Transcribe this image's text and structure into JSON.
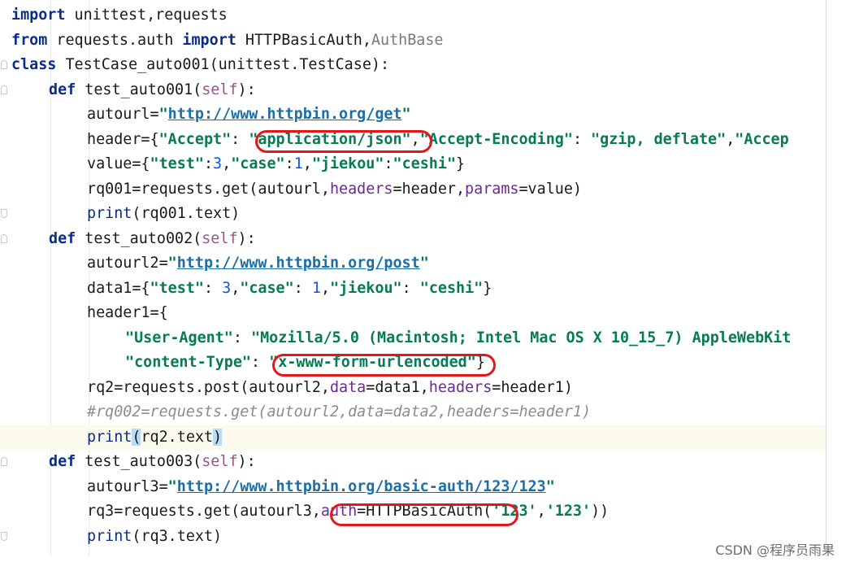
{
  "lines": [
    {
      "indent": 0,
      "parts": [
        [
          "import",
          "kw"
        ],
        [
          " unittest,requests",
          "plain"
        ]
      ]
    },
    {
      "indent": 0,
      "parts": [
        [
          "from",
          "kw"
        ],
        [
          " requests.auth ",
          "plain"
        ],
        [
          "import",
          "kw"
        ],
        [
          " HTTPBasicAuth,",
          "plain"
        ],
        [
          "AuthBase",
          "cmt-plain"
        ]
      ]
    },
    {
      "indent": 0,
      "parts": [
        [
          "class",
          "kw"
        ],
        [
          " TestCase_auto001(unittest.TestCase):",
          "plain"
        ]
      ]
    },
    {
      "indent": 1,
      "parts": [
        [
          "def",
          "kw"
        ],
        [
          " test_auto001(",
          "plain"
        ],
        [
          "self",
          "self"
        ],
        [
          "):",
          "plain"
        ]
      ]
    },
    {
      "indent": 2,
      "parts": [
        [
          "autourl=",
          "plain"
        ],
        [
          "\"",
          "str"
        ],
        [
          "http://www.httpbin.org/get",
          "url"
        ],
        [
          "\"",
          "str"
        ]
      ]
    },
    {
      "indent": 2,
      "parts": [
        [
          "header={",
          "plain"
        ],
        [
          "\"Accept\"",
          "str"
        ],
        [
          ": ",
          "plain"
        ],
        [
          "\"application/json\"",
          "str"
        ],
        [
          ",",
          "plain"
        ],
        [
          "\"Accept-Encoding\"",
          "str"
        ],
        [
          ": ",
          "plain"
        ],
        [
          "\"gzip, deflate\"",
          "str"
        ],
        [
          ",",
          "plain"
        ],
        [
          "\"Accep",
          "str"
        ]
      ]
    },
    {
      "indent": 2,
      "parts": [
        [
          "value={",
          "plain"
        ],
        [
          "\"test\"",
          "str"
        ],
        [
          ":",
          "plain"
        ],
        [
          "3",
          "num"
        ],
        [
          ",",
          "plain"
        ],
        [
          "\"case\"",
          "str"
        ],
        [
          ":",
          "plain"
        ],
        [
          "1",
          "num"
        ],
        [
          ",",
          "plain"
        ],
        [
          "\"jiekou\"",
          "str"
        ],
        [
          ":",
          "plain"
        ],
        [
          "\"ceshi\"",
          "str"
        ],
        [
          "}",
          "plain"
        ]
      ]
    },
    {
      "indent": 2,
      "parts": [
        [
          "rq001=requests.get(autourl,",
          "plain"
        ],
        [
          "headers",
          "param"
        ],
        [
          "=header,",
          "plain"
        ],
        [
          "params",
          "param"
        ],
        [
          "=value)",
          "plain"
        ]
      ]
    },
    {
      "indent": 2,
      "parts": [
        [
          "print",
          "builtin"
        ],
        [
          "(rq001.text)",
          "plain"
        ]
      ]
    },
    {
      "indent": 1,
      "parts": [
        [
          "def",
          "kw"
        ],
        [
          " test_auto002(",
          "plain"
        ],
        [
          "self",
          "self"
        ],
        [
          "):",
          "plain"
        ]
      ]
    },
    {
      "indent": 2,
      "parts": [
        [
          "autourl2=",
          "plain"
        ],
        [
          "\"",
          "str"
        ],
        [
          "http://www.httpbin.org/post",
          "url"
        ],
        [
          "\"",
          "str"
        ]
      ]
    },
    {
      "indent": 2,
      "parts": [
        [
          "data1={",
          "plain"
        ],
        [
          "\"test\"",
          "str"
        ],
        [
          ": ",
          "plain"
        ],
        [
          "3",
          "num"
        ],
        [
          ",",
          "plain"
        ],
        [
          "\"case\"",
          "str"
        ],
        [
          ": ",
          "plain"
        ],
        [
          "1",
          "num"
        ],
        [
          ",",
          "plain"
        ],
        [
          "\"jiekou\"",
          "str"
        ],
        [
          ": ",
          "plain"
        ],
        [
          "\"ceshi\"",
          "str"
        ],
        [
          "}",
          "plain"
        ]
      ]
    },
    {
      "indent": 2,
      "parts": [
        [
          "header1={",
          "plain"
        ]
      ]
    },
    {
      "indent": 3,
      "parts": [
        [
          "\"User-Agent\"",
          "str"
        ],
        [
          ": ",
          "plain"
        ],
        [
          "\"Mozilla/5.0 (Macintosh; Intel Mac OS X 10_15_7) AppleWebKit",
          "str"
        ]
      ]
    },
    {
      "indent": 3,
      "parts": [
        [
          "\"content-Type\"",
          "str"
        ],
        [
          ": ",
          "plain"
        ],
        [
          "\"x-www-form-urlencoded\"",
          "str"
        ],
        [
          "}",
          "plain"
        ]
      ]
    },
    {
      "indent": 2,
      "parts": [
        [
          "rq2=requests.post(autourl2,",
          "plain"
        ],
        [
          "data",
          "param"
        ],
        [
          "=data1,",
          "plain"
        ],
        [
          "headers",
          "param"
        ],
        [
          "=header1)",
          "plain"
        ]
      ]
    },
    {
      "indent": 2,
      "parts": [
        [
          "#rq002=requests.get(autourl2,data=data2,headers=header1)",
          "cmt"
        ]
      ]
    },
    {
      "indent": 2,
      "current": true,
      "parts": [
        [
          "print",
          "builtin"
        ],
        [
          "(",
          "bracket"
        ],
        [
          "rq2.text",
          "plain"
        ],
        [
          ")",
          "bracket"
        ]
      ]
    },
    {
      "indent": 1,
      "parts": [
        [
          "def",
          "kw"
        ],
        [
          " test_auto003(",
          "plain"
        ],
        [
          "self",
          "self"
        ],
        [
          "):",
          "plain"
        ]
      ]
    },
    {
      "indent": 2,
      "parts": [
        [
          "autourl3=",
          "plain"
        ],
        [
          "\"",
          "str"
        ],
        [
          "http://www.httpbin.org/basic-auth/123/123",
          "url"
        ],
        [
          "\"",
          "str"
        ]
      ]
    },
    {
      "indent": 2,
      "parts": [
        [
          "rq3=requests.get(autourl3,",
          "plain"
        ],
        [
          "auth",
          "param"
        ],
        [
          "=HTTPBasicAuth(",
          "plain"
        ],
        [
          "'123'",
          "str"
        ],
        [
          ",",
          "plain"
        ],
        [
          "'123'",
          "str"
        ],
        [
          "))",
          "plain"
        ]
      ]
    },
    {
      "indent": 2,
      "parts": [
        [
          "print",
          "builtin"
        ],
        [
          "(rq3.text)",
          "plain"
        ]
      ]
    }
  ],
  "watermark": "CSDN @程序员雨果",
  "annotations": [
    "application/json highlight",
    "x-www-form-urlencoded highlight",
    "auth=HTTPBasicAuth( highlight"
  ]
}
